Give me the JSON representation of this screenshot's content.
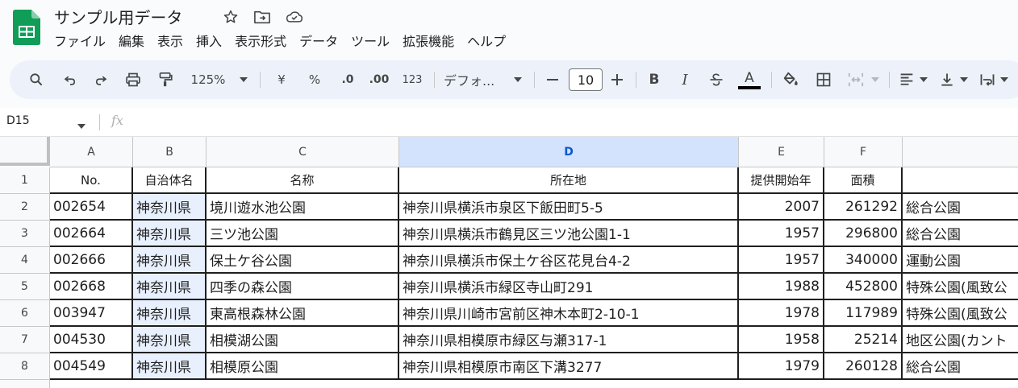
{
  "doc": {
    "title": "サンプル用データ"
  },
  "menu": [
    "ファイル",
    "編集",
    "表示",
    "挿入",
    "表示形式",
    "データ",
    "ツール",
    "拡張機能",
    "ヘルプ"
  ],
  "toolbar": {
    "zoom": "125%",
    "currency": "¥",
    "percent": "%",
    "dec_decrease": ".0",
    "dec_increase": ".00",
    "number_format": "123",
    "font": "デフォ...",
    "font_size": "10",
    "bold": "B",
    "italic": "I",
    "text_color": "A"
  },
  "formula": {
    "namebox": "D15",
    "fx": "fx"
  },
  "columns": [
    "A",
    "B",
    "C",
    "D",
    "E",
    "F"
  ],
  "rows": [
    "1",
    "2",
    "3",
    "4",
    "5",
    "6",
    "7",
    "8"
  ],
  "header": [
    "No.",
    "自治体名",
    "名称",
    "所在地",
    "提供開始年",
    "面積"
  ],
  "data": [
    [
      "002654",
      "神奈川県",
      "境川遊水池公園",
      "神奈川県横浜市泉区下飯田町5-5",
      "2007",
      "261292",
      "総合公園"
    ],
    [
      "002664",
      "神奈川県",
      "三ツ池公園",
      "神奈川県横浜市鶴見区三ツ池公園1-1",
      "1957",
      "296800",
      "総合公園"
    ],
    [
      "002666",
      "神奈川県",
      "保土ケ谷公園",
      "神奈川県横浜市保土ケ谷区花見台4-2",
      "1957",
      "340000",
      "運動公園"
    ],
    [
      "002668",
      "神奈川県",
      "四季の森公園",
      "神奈川県横浜市緑区寺山町291",
      "1988",
      "452800",
      "特殊公園(風致公"
    ],
    [
      "003947",
      "神奈川県",
      "東高根森林公園",
      "神奈川県川崎市宮前区神木本町2-10-1",
      "1978",
      "117989",
      "特殊公園(風致公"
    ],
    [
      "004530",
      "神奈川県",
      "相模湖公園",
      "神奈川県相模原市緑区与瀬317-1",
      "1958",
      "25214",
      "地区公園(カント"
    ],
    [
      "004549",
      "神奈川県",
      "相模原公園",
      "神奈川県相模原市南区下溝3277",
      "1979",
      "260128",
      "総合公園"
    ]
  ],
  "colors": {
    "selected_col": "#d3e3fd",
    "selected_cell": "#e8f0fe",
    "accent": "#0b57d0",
    "sheets_green": "#0f9d58"
  }
}
